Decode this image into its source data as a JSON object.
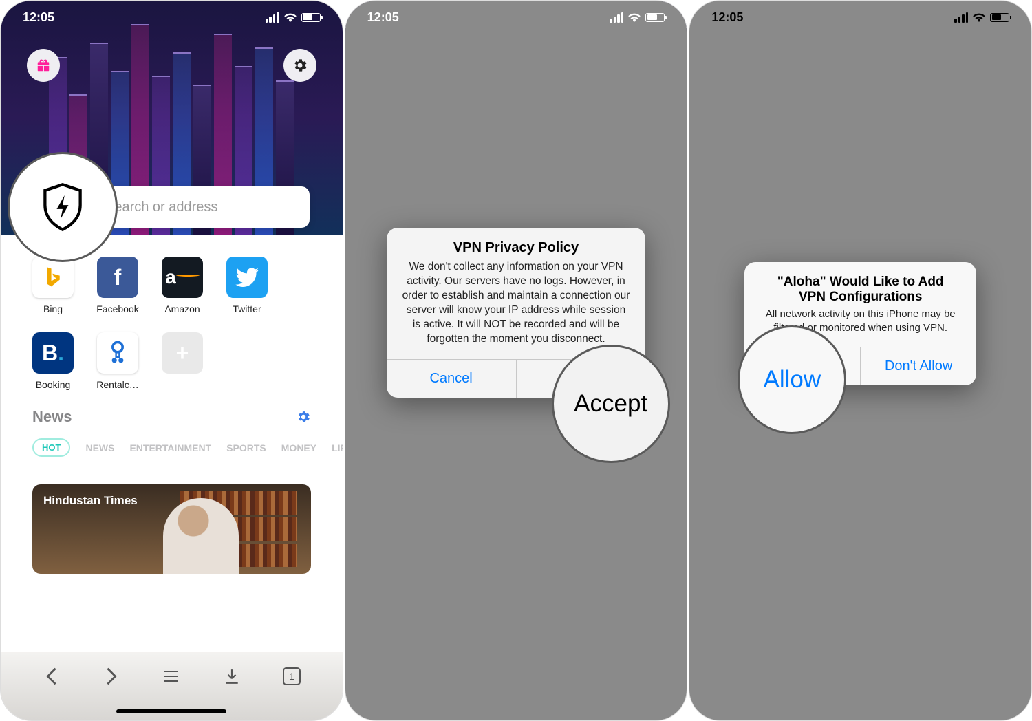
{
  "status_time": "12:05",
  "search_placeholder": "Search or address",
  "tiles": [
    {
      "label": "Bing",
      "icon": "b"
    },
    {
      "label": "Facebook",
      "icon": "f"
    },
    {
      "label": "Amazon",
      "icon": "a"
    },
    {
      "label": "Twitter",
      "icon": "🐦"
    },
    {
      "label": "Booking",
      "icon": "B."
    },
    {
      "label": "Rentalc…",
      "icon": "◉"
    }
  ],
  "add_tile_icon": "+",
  "news": {
    "title": "News",
    "tabs": [
      "HOT",
      "NEWS",
      "ENTERTAINMENT",
      "SPORTS",
      "MONEY",
      "LIFES"
    ]
  },
  "article_source": "Hindustan Times",
  "tab_count": "1",
  "vpn_modal": {
    "title": "VPN Privacy Policy",
    "message": "We don't collect any information on your VPN activity. Our servers have no logs. However, in order to establish and maintain a connection our server will know your IP address while session is active. It will NOT be recorded and will be forgotten the moment you disconnect.",
    "cancel": "Cancel",
    "accept": "Accept"
  },
  "sys_modal": {
    "title": "\"Aloha\" Would Like to Add VPN Configurations",
    "message": "All network activity on this iPhone may be filtered or monitored when using VPN.",
    "allow": "Allow",
    "dont_allow": "Don't Allow"
  },
  "highlight_accept": "Accept",
  "highlight_allow": "Allow"
}
